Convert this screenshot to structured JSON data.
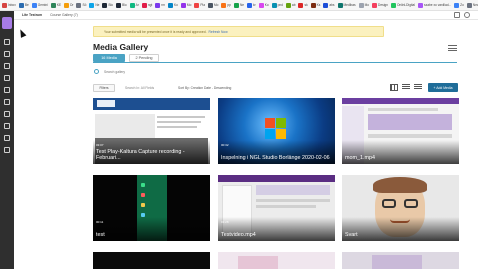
{
  "browser": {
    "bookmarks": [
      {
        "label": "Inbox",
        "color": "#d64541"
      },
      {
        "label": "Be",
        "color": "#2b6cb0"
      },
      {
        "label": "Gemini",
        "color": "#3b82f6"
      },
      {
        "label": "KE",
        "color": "#2f855a"
      },
      {
        "label": "Dr",
        "color": "#f59e0b"
      },
      {
        "label": "Sö",
        "color": "#6b7280"
      },
      {
        "label": "Ne",
        "color": "#0ea5e9"
      },
      {
        "label": "Blo",
        "color": "#1f2937"
      },
      {
        "label": "Blo",
        "color": "#1f2937"
      },
      {
        "label": "Ar",
        "color": "#10b981"
      },
      {
        "label": "ngt",
        "color": "#e11d48"
      },
      {
        "label": "rm",
        "color": "#7c3aed"
      },
      {
        "label": "Ko",
        "color": "#0284c7"
      },
      {
        "label": "Mo",
        "color": "#9333ea"
      },
      {
        "label": "Pla",
        "color": "#ef4444"
      },
      {
        "label": "Mo",
        "color": "#4b5563"
      },
      {
        "label": "pp",
        "color": "#f97316"
      },
      {
        "label": "Ne",
        "color": "#16a34a"
      },
      {
        "label": "kr",
        "color": "#2563eb"
      },
      {
        "label": "Ko",
        "color": "#d946ef"
      },
      {
        "label": "pnd",
        "color": "#0891b2"
      },
      {
        "label": "ab",
        "color": "#65a30d"
      },
      {
        "label": "sk",
        "color": "#dc2626"
      },
      {
        "label": "Ks",
        "color": "#7c2d12"
      },
      {
        "label": "abs",
        "color": "#1d4ed8"
      },
      {
        "label": "Medibas",
        "color": "#0f766e"
      },
      {
        "label": "Mo",
        "color": "#9ca3af"
      },
      {
        "label": "Design",
        "color": "#f43f5e"
      },
      {
        "label": "Onlinl-Digital",
        "color": "#22c55e"
      },
      {
        "label": "szabe xo vanillad...",
        "color": "#a855f7"
      },
      {
        "label": "Zo",
        "color": "#3b82f6"
      },
      {
        "label": "New Tab",
        "color": "#6b7280"
      },
      {
        "label": "Mo",
        "color": "#6b7280"
      },
      {
        "label": "MoQM",
        "color": "#ea580c"
      }
    ]
  },
  "topbar": {
    "crumb1": "Lite Testrum",
    "crumb2": "Course Gallery (7)"
  },
  "notice": {
    "text": "Your submitted media will be presented once it is ready and approved.",
    "link": "Refresh Now"
  },
  "page": {
    "title": "Media Gallery",
    "tabs": [
      {
        "label": "16 Media"
      },
      {
        "label": "2 Pending"
      }
    ],
    "search_placeholder": "Search gallery",
    "filters_label": "Filters",
    "search_in_label": "Search In: All Fields",
    "sort_label": "Sort By: Creation Date - Descending",
    "add_media_label": "+ Add Media"
  },
  "media": [
    {
      "duration": "03:07",
      "name": "Test Play-Kaltura Capture recording - Februari...",
      "thumb": "slides"
    },
    {
      "duration": "00:32",
      "name": "Inspelning i NGL Studio Borlänge 2020-02-06",
      "thumb": "windows"
    },
    {
      "duration": "",
      "name": "mom_1.mp4",
      "thumb": "purple"
    },
    {
      "duration": "00:11",
      "name": "test",
      "thumb": "phone"
    },
    {
      "duration": "01:28",
      "name": "Testvideo.mp4",
      "thumb": "screen"
    },
    {
      "duration": "",
      "name": "Svart",
      "thumb": "avatar"
    },
    {
      "duration": "",
      "name": "",
      "thumb": "dark"
    },
    {
      "duration": "",
      "name": "",
      "thumb": "light"
    },
    {
      "duration": "",
      "name": "",
      "thumb": "light2"
    }
  ],
  "colors": {
    "accent": "#4aa3c4",
    "rail": "#2f2f2f",
    "notice_bg": "#fbf1bf",
    "add_button": "#1f6d99"
  }
}
